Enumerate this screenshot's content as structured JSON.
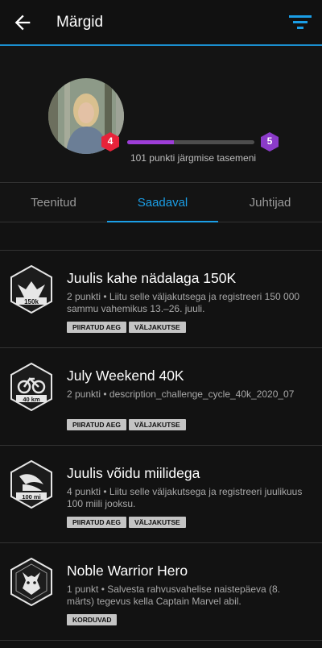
{
  "header": {
    "title": "Märgid"
  },
  "profile": {
    "current_level": "4",
    "next_level": "5",
    "progress": 0.37,
    "points_text": "101 punkti järgmise tasemeni",
    "level_colors": {
      "current": "#e8233a",
      "next": "#8b3bc9"
    }
  },
  "tabs": [
    {
      "label": "Teenitud"
    },
    {
      "label": "Saadaval",
      "active": true
    },
    {
      "label": "Juhtijad"
    }
  ],
  "badges": [
    {
      "name": "Juulis kahe nädalaga 150K",
      "desc": "2 punkti • Liitu selle väljakutsega ja registreeri 150 000 sammu vahemikus 13.–26. juuli.",
      "tags": [
        "PIIRATUD AEG",
        "VÄLJAKUTSE"
      ],
      "icon_text": "150k"
    },
    {
      "name": "July Weekend 40K",
      "desc": "2 punkti • description_challenge_cycle_40k_2020_07",
      "tags": [
        "PIIRATUD AEG",
        "VÄLJAKUTSE"
      ],
      "icon_text": "40 km"
    },
    {
      "name": "Juulis võidu miilidega",
      "desc": "4 punkti • Liitu selle väljakutsega ja registreeri juulikuus 100 miili jooksu.",
      "tags": [
        "PIIRATUD AEG",
        "VÄLJAKUTSE"
      ],
      "icon_text": "100 mi"
    },
    {
      "name": "Noble Warrior Hero",
      "desc": "1 punkt • Salvesta rahvusvahelise naistepäeva (8. märts) tegevus kella Captain Marvel abil.",
      "tags": [
        "KORDUVAD"
      ],
      "icon_text": ""
    }
  ]
}
